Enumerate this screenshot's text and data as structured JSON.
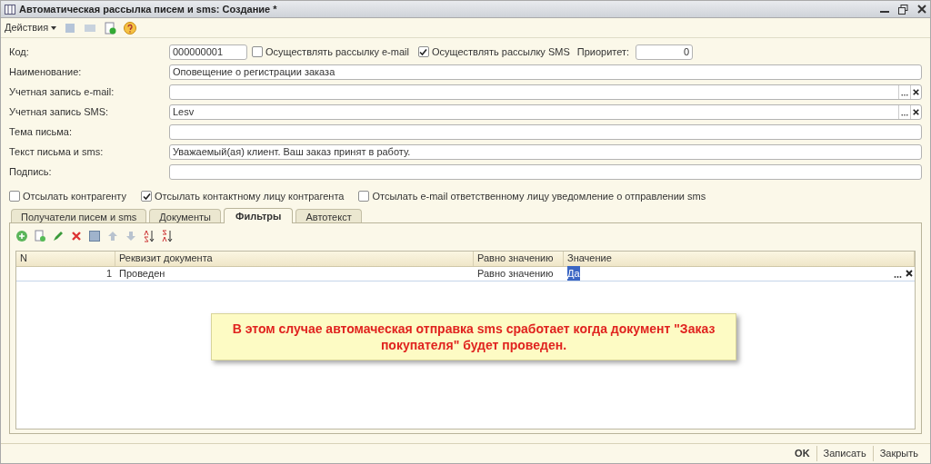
{
  "window": {
    "title": "Автоматическая рассылка писем и sms: Создание *"
  },
  "toolbar": {
    "actions_label": "Действия"
  },
  "header_row": {
    "code_label": "Код:",
    "code_value": "000000001",
    "email_check": {
      "label": "Осуществлять рассылку e-mail",
      "checked": false
    },
    "sms_check": {
      "label": "Осуществлять рассылку SMS",
      "checked": true
    },
    "priority_label": "Приоритет:",
    "priority_value": "0"
  },
  "fields": [
    {
      "label": "Наименование:",
      "value": "Оповещение о регистрации заказа",
      "kind": "text"
    },
    {
      "label": "Учетная запись e-mail:",
      "kind": "choice"
    },
    {
      "label": "Учетная запись SMS:",
      "value": "Lesv",
      "kind": "choice"
    },
    {
      "label": "Тема письма:",
      "kind": "text"
    },
    {
      "label": "Текст письма и sms:",
      "value": "Уважаемый(ая) клиент. Ваш заказ принят в работу.",
      "kind": "text"
    },
    {
      "label": "Подпись:",
      "kind": "text"
    }
  ],
  "options": [
    {
      "label": "Отсылать контрагенту",
      "checked": false
    },
    {
      "label": "Отсылать контактному лицу контрагента",
      "checked": true
    },
    {
      "label": "Отсылать e-mail ответственному лицу уведомление о отправлении sms",
      "checked": false
    }
  ],
  "tabs": [
    {
      "label": "Получатели писем и sms",
      "selected": false
    },
    {
      "label": "Документы",
      "selected": false
    },
    {
      "label": "Фильтры",
      "selected": true
    },
    {
      "label": "Автотекст",
      "selected": false
    }
  ],
  "table": {
    "columns": [
      "N",
      "Реквизит документа",
      "Равно значению",
      "Значение"
    ],
    "rows": [
      {
        "cells": [
          "1",
          "Проведен",
          "Равно значению",
          "Да"
        ],
        "selected": true
      }
    ]
  },
  "callout": {
    "text": "В этом случае автомаческая отправка sms сработает когда документ \"Заказ покупателя\" будет проведен."
  },
  "footer": {
    "buttons": [
      {
        "label": "OK",
        "kind": "default"
      },
      {
        "label": "Записать",
        "kind": "normal"
      },
      {
        "label": "Закрыть",
        "kind": "normal"
      }
    ]
  }
}
